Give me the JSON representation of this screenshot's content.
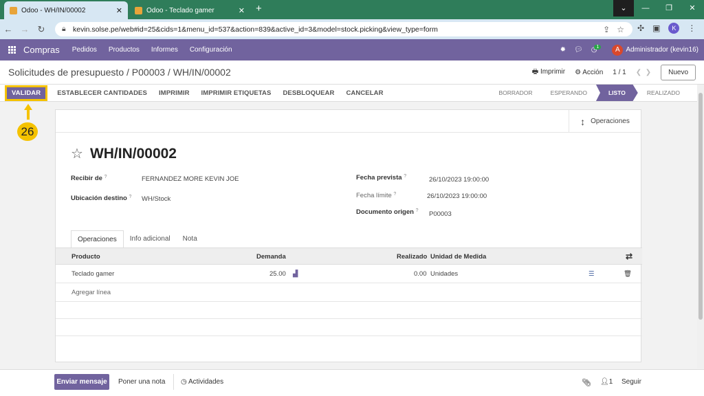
{
  "browser": {
    "tabs": [
      {
        "title": "Odoo - WH/IN/00002",
        "active": true
      },
      {
        "title": "Odoo - Teclado gamer",
        "active": false
      }
    ],
    "url": "kevin.solse.pe/web#id=25&cids=1&menu_id=537&action=839&active_id=3&model=stock.picking&view_type=form",
    "profile_initial": "K"
  },
  "navbar": {
    "app_name": "Compras",
    "menu": [
      "Pedidos",
      "Productos",
      "Informes",
      "Configuración"
    ],
    "activity_count": "1",
    "user_initial": "A",
    "user_name": "Administrador (kevin16)"
  },
  "control_panel": {
    "breadcrumb": "Solicitudes de presupuesto / P00003 / WH/IN/00002",
    "print": "Imprimir",
    "action": "Acción",
    "pager": "1 / 1",
    "new_button": "Nuevo"
  },
  "action_bar": {
    "buttons": [
      "VALIDAR",
      "ESTABLECER CANTIDADES",
      "IMPRIMIR",
      "IMPRIMIR ETIQUETAS",
      "DESBLOQUEAR",
      "CANCELAR"
    ],
    "statuses": [
      "BORRADOR",
      "ESPERANDO",
      "LISTO",
      "REALIZADO"
    ],
    "active_status": "LISTO"
  },
  "annotation": {
    "step": "26",
    "color": "#f5c200"
  },
  "form": {
    "operations_button": "Operaciones",
    "title": "WH/IN/00002",
    "recibir_de_label": "Recibir de",
    "recibir_de_value": "FERNANDEZ MORE KEVIN JOE",
    "ubicacion_label": "Ubicación destino",
    "ubicacion_value": "WH/Stock",
    "fecha_prevista_label": "Fecha prevista",
    "fecha_prevista_value": "26/10/2023 19:00:00",
    "fecha_limite_label": "Fecha límite",
    "fecha_limite_value": "26/10/2023 19:00:00",
    "documento_label": "Documento origen",
    "documento_value": "P00003",
    "help_mark": "?",
    "tabs": [
      "Operaciones",
      "Info adicional",
      "Nota"
    ],
    "table": {
      "headers": {
        "product": "Producto",
        "demand": "Demanda",
        "done": "Realizado",
        "uom": "Unidad de Medida"
      },
      "rows": [
        {
          "product": "Teclado gamer",
          "demand": "25.00",
          "done": "0.00",
          "uom": "Unidades"
        }
      ],
      "add_line": "Agregar línea"
    }
  },
  "chatter": {
    "send": "Enviar mensaje",
    "note": "Poner una nota",
    "activities": "Actividades",
    "followers": "1",
    "follow": "Seguir"
  },
  "colors": {
    "brand": "#71639e",
    "highlight": "#f5c200",
    "chrome": "#2f7d5a"
  }
}
